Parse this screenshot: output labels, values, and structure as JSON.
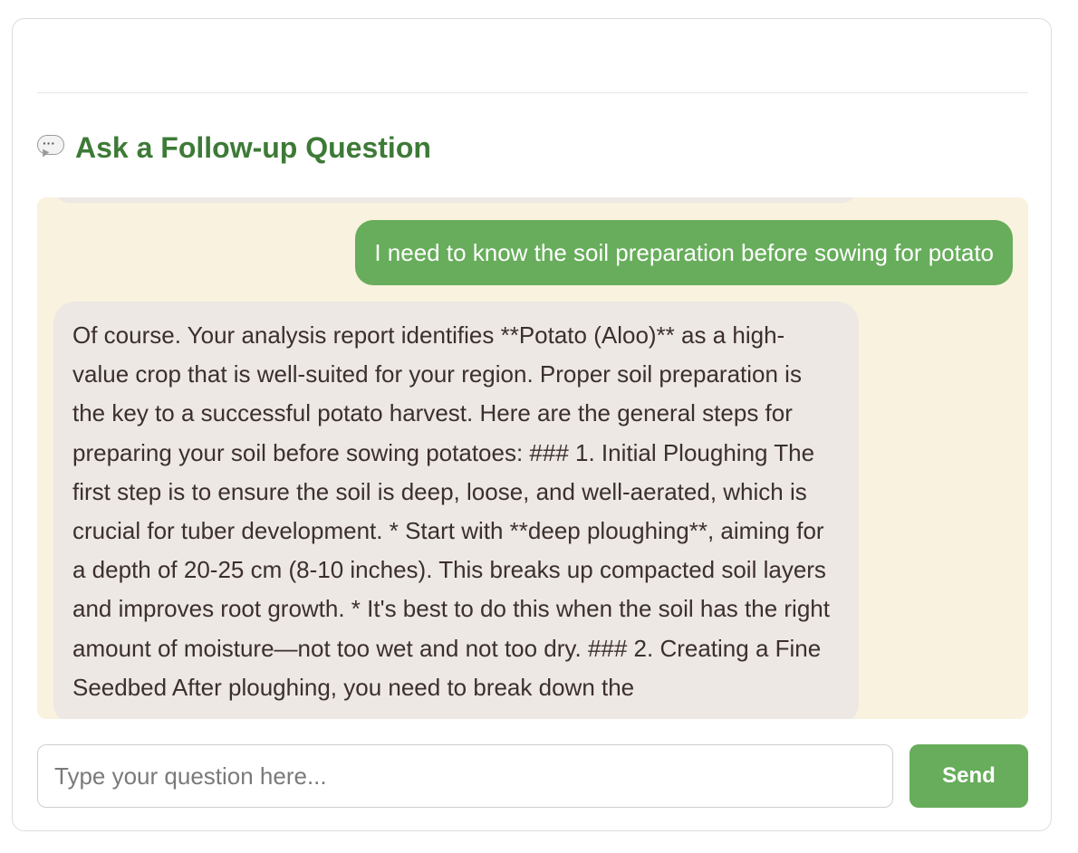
{
  "section": {
    "title": "Ask a Follow-up Question",
    "icon": "speech-bubble-icon"
  },
  "chat": {
    "messages": [
      {
        "role": "user",
        "text": "I need to know the soil preparation before sowing for potato"
      },
      {
        "role": "assistant",
        "text": "Of course. Your analysis report identifies **Potato (Aloo)** as a high-value crop that is well-suited for your region. Proper soil preparation is the key to a successful potato harvest. Here are the general steps for preparing your soil before sowing potatoes: ### 1. Initial Ploughing The first step is to ensure the soil is deep, loose, and well-aerated, which is crucial for tuber development. * Start with **deep ploughing**, aiming for a depth of 20-25 cm (8-10 inches). This breaks up compacted soil layers and improves root growth. * It's best to do this when the soil has the right amount of moisture—not too wet and not too dry. ### 2. Creating a Fine Seedbed After ploughing, you need to break down the"
      }
    ]
  },
  "input": {
    "placeholder": "Type your question here...",
    "value": ""
  },
  "send_button": {
    "label": "Send"
  },
  "colors": {
    "title_green": "#3d7a37",
    "button_green": "#67ad5b",
    "chat_bg": "#f8f2df",
    "assistant_bubble": "#ede8e3"
  }
}
